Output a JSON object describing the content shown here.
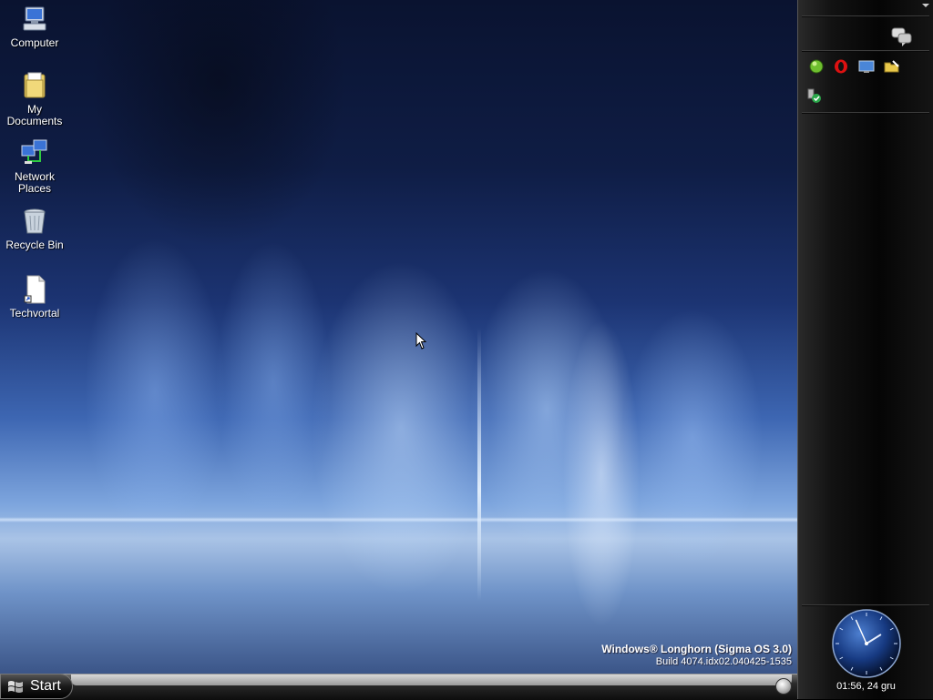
{
  "desktop_icons": [
    {
      "label": "Computer",
      "icon": "computer-icon"
    },
    {
      "label": "My Documents",
      "icon": "documents-folder-icon"
    },
    {
      "label": "Network Places",
      "icon": "network-icon"
    },
    {
      "label": "Recycle Bin",
      "icon": "recycle-bin-icon"
    },
    {
      "label": "Techvortal",
      "icon": "shortcut-file-icon"
    }
  ],
  "watermark": {
    "line1": "Windows® Longhorn (Sigma OS 3.0)",
    "line2": "Build 4074.idx02.040425-1535"
  },
  "taskbar": {
    "start_label": "Start"
  },
  "sidebar": {
    "tiles": [
      "messenger-icon",
      "green-globe-icon",
      "opera-icon",
      "monitor-icon",
      "folder-edit-icon",
      "security-check-icon"
    ],
    "clock": {
      "text": "01:56, 24 gru",
      "hour": 1,
      "minute": 56
    }
  },
  "colors": {
    "desktop_dark": "#0f1d45",
    "desktop_light": "#a9c3e6",
    "sidebar": "#0a0a0a"
  }
}
